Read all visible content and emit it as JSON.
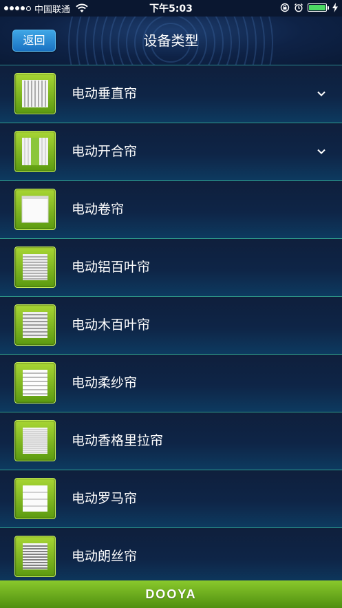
{
  "status_bar": {
    "carrier": "中国联通",
    "time": "下午5:03",
    "battery_color": "#4cd964",
    "icons": [
      "signal-dots-icon",
      "wifi-icon",
      "rotation-lock-icon",
      "alarm-icon",
      "battery-icon",
      "charging-icon"
    ]
  },
  "navbar": {
    "back_label": "返回",
    "title": "设备类型"
  },
  "devices": [
    {
      "label": "电动垂直帘",
      "icon": "vertical-blind-icon",
      "expandable": true
    },
    {
      "label": "电动开合帘",
      "icon": "curtain-icon",
      "expandable": true
    },
    {
      "label": "电动卷帘",
      "icon": "roller-blind-icon",
      "expandable": false
    },
    {
      "label": "电动铝百叶帘",
      "icon": "aluminum-venetian-blind-icon",
      "expandable": false
    },
    {
      "label": "电动木百叶帘",
      "icon": "wood-venetian-blind-icon",
      "expandable": false
    },
    {
      "label": "电动柔纱帘",
      "icon": "soft-gauze-blind-icon",
      "expandable": false
    },
    {
      "label": "电动香格里拉帘",
      "icon": "shangri-la-blind-icon",
      "expandable": false
    },
    {
      "label": "电动罗马帘",
      "icon": "roman-blind-icon",
      "expandable": false
    },
    {
      "label": "电动朗丝帘",
      "icon": "sheer-blind-icon",
      "expandable": false
    }
  ],
  "footer": {
    "brand": "DOOYA",
    "bg_color": "#6aad1e"
  }
}
